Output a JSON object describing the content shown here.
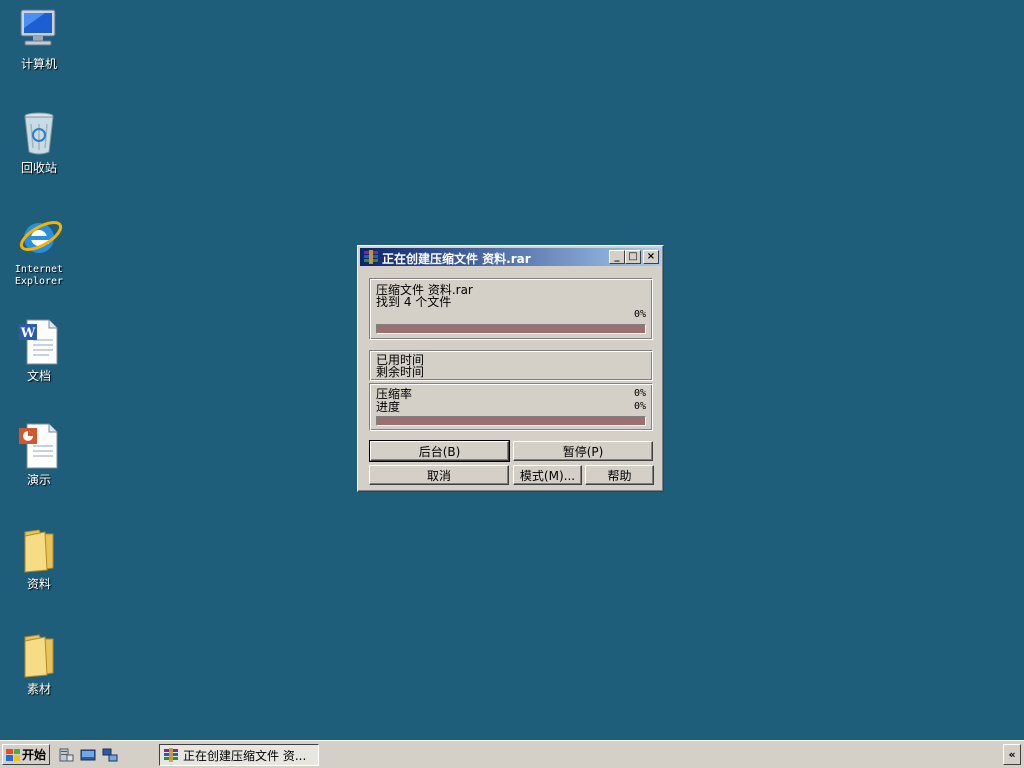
{
  "desktop": {
    "icons": [
      {
        "label": "计算机",
        "icon": "computer-icon"
      },
      {
        "label": "回收站",
        "icon": "recycle-bin-icon"
      },
      {
        "label": "Internet Explorer",
        "icon": "internet-explorer-icon"
      },
      {
        "label": "文档",
        "icon": "word-document-icon"
      },
      {
        "label": "演示",
        "icon": "powerpoint-document-icon"
      },
      {
        "label": "资料",
        "icon": "folder-icon"
      },
      {
        "label": "素材",
        "icon": "folder-icon"
      }
    ]
  },
  "dialog": {
    "title": "正在创建压缩文件 资料.rar",
    "icon": "winrar-icon",
    "archive_line": "压缩文件 资料.rar",
    "found_line": "找到 4 个文件",
    "file_progress_text": "0%",
    "file_progress": 0,
    "elapsed_label": "已用时间",
    "remaining_label": "剩余时间",
    "ratio_label": "压缩率",
    "ratio_value": "0%",
    "progress_label": "进度",
    "progress_value": "0%",
    "total_progress": 0,
    "buttons": {
      "background": "后台(B)",
      "pause": "暂停(P)",
      "cancel": "取消",
      "mode": "模式(M)...",
      "help": "帮助"
    },
    "title_buttons": {
      "minimize": "_",
      "maximize": "□",
      "close": "×"
    }
  },
  "taskbar": {
    "start_label": "开始",
    "task_label": "正在创建压缩文件 资...",
    "tray_toggle": "«"
  },
  "colors": {
    "desktop": "#1f5e7a",
    "title_gradient_start": "#0a246a",
    "title_gradient_end": "#a6caf0",
    "progress_track": "#9c7070"
  }
}
